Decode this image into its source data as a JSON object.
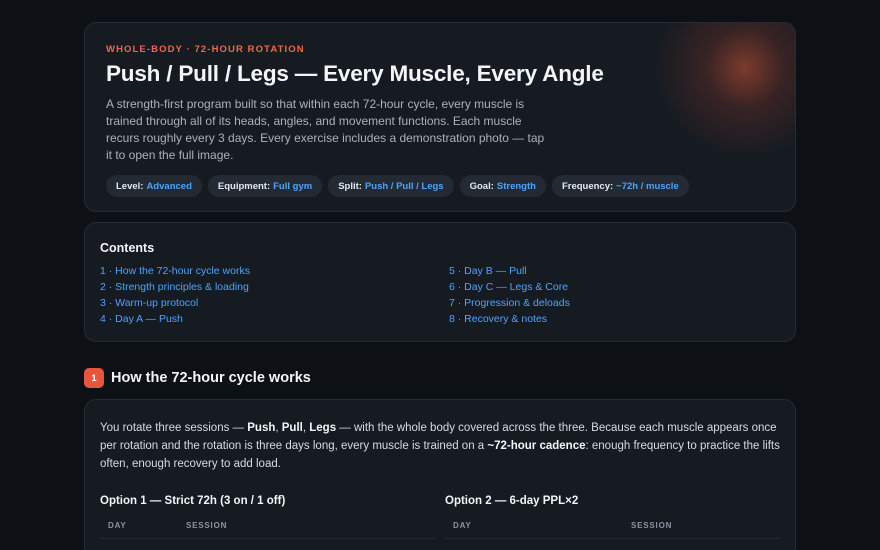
{
  "hero": {
    "eyebrow": "WHOLE-BODY · 72-HOUR ROTATION",
    "title": "Push / Pull / Legs — Every Muscle, Every Angle",
    "description": "A strength-first program built so that within each 72-hour cycle, every muscle is trained through all of its heads, angles, and movement functions. Each muscle recurs roughly every 3 days. Every exercise includes a demonstration photo — tap it to open the full image.",
    "chips": [
      {
        "label": "Level:",
        "value": "Advanced"
      },
      {
        "label": "Equipment:",
        "value": "Full gym"
      },
      {
        "label": "Split:",
        "value": "Push / Pull / Legs"
      },
      {
        "label": "Goal:",
        "value": "Strength"
      },
      {
        "label": "Frequency:",
        "value": "~72h / muscle"
      }
    ]
  },
  "toc": {
    "title": "Contents",
    "items": [
      "1 · How the 72-hour cycle works",
      "5 · Day B — Pull",
      "2 · Strength principles & loading",
      "6 · Day C — Legs & Core",
      "3 · Warm-up protocol",
      "7 · Progression & deloads",
      "4 · Day A — Push",
      "8 · Recovery & notes"
    ]
  },
  "section1": {
    "number": "1",
    "title": "How the 72-hour cycle works",
    "lead": {
      "t1": "You rotate three sessions — ",
      "b1": "Push",
      "t2": ", ",
      "b2": "Pull",
      "t3": ", ",
      "b3": "Legs",
      "t4": " — with the whole body covered across the three. Because each muscle appears once per rotation and the rotation is three days long, every muscle is trained on a ",
      "b4": "~72-hour cadence",
      "t5": ": enough frequency to practice the lifts often, enough recovery to add load."
    },
    "options": [
      {
        "title": "Option 1 — Strict 72h (3 on / 1 off)",
        "col1": "DAY",
        "col2": "SESSION"
      },
      {
        "title": "Option 2 — 6-day PPL×2",
        "col1": "DAY",
        "col2": "SESSION"
      }
    ]
  },
  "colors": {
    "accent": "#e7553c",
    "link": "#4da3ff",
    "background": "#0d1014",
    "card": "#161b22"
  }
}
